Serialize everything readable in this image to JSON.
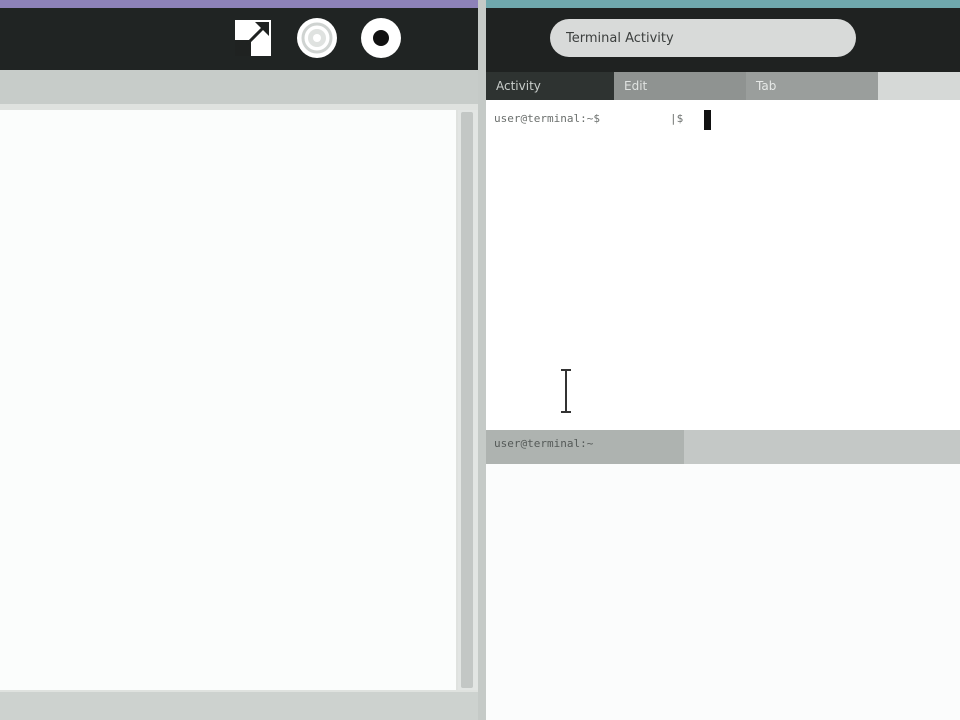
{
  "left_panel": {
    "toolbar": {
      "buttons": [
        {
          "name": "fullscreen",
          "icon": "fullscreen-icon"
        },
        {
          "name": "settings",
          "icon": "settings-gear-icon"
        },
        {
          "name": "record",
          "icon": "record-icon"
        }
      ]
    }
  },
  "right_panel": {
    "search": {
      "value": "Terminal Activity"
    },
    "tabs": [
      {
        "label": "Activity",
        "active": true
      },
      {
        "label": "Edit",
        "active": false
      },
      {
        "label": "Tab",
        "active": false
      }
    ],
    "terminal": {
      "prompt": "user@terminal:~$",
      "prompt_symbol": "|$"
    },
    "status_bar": {
      "text": "user@terminal:~"
    }
  },
  "colors": {
    "left_accent": "#8d82b8",
    "right_accent": "#6fa8ad",
    "toolbar_bg": "#202423",
    "active_tab": "#2e3331"
  }
}
